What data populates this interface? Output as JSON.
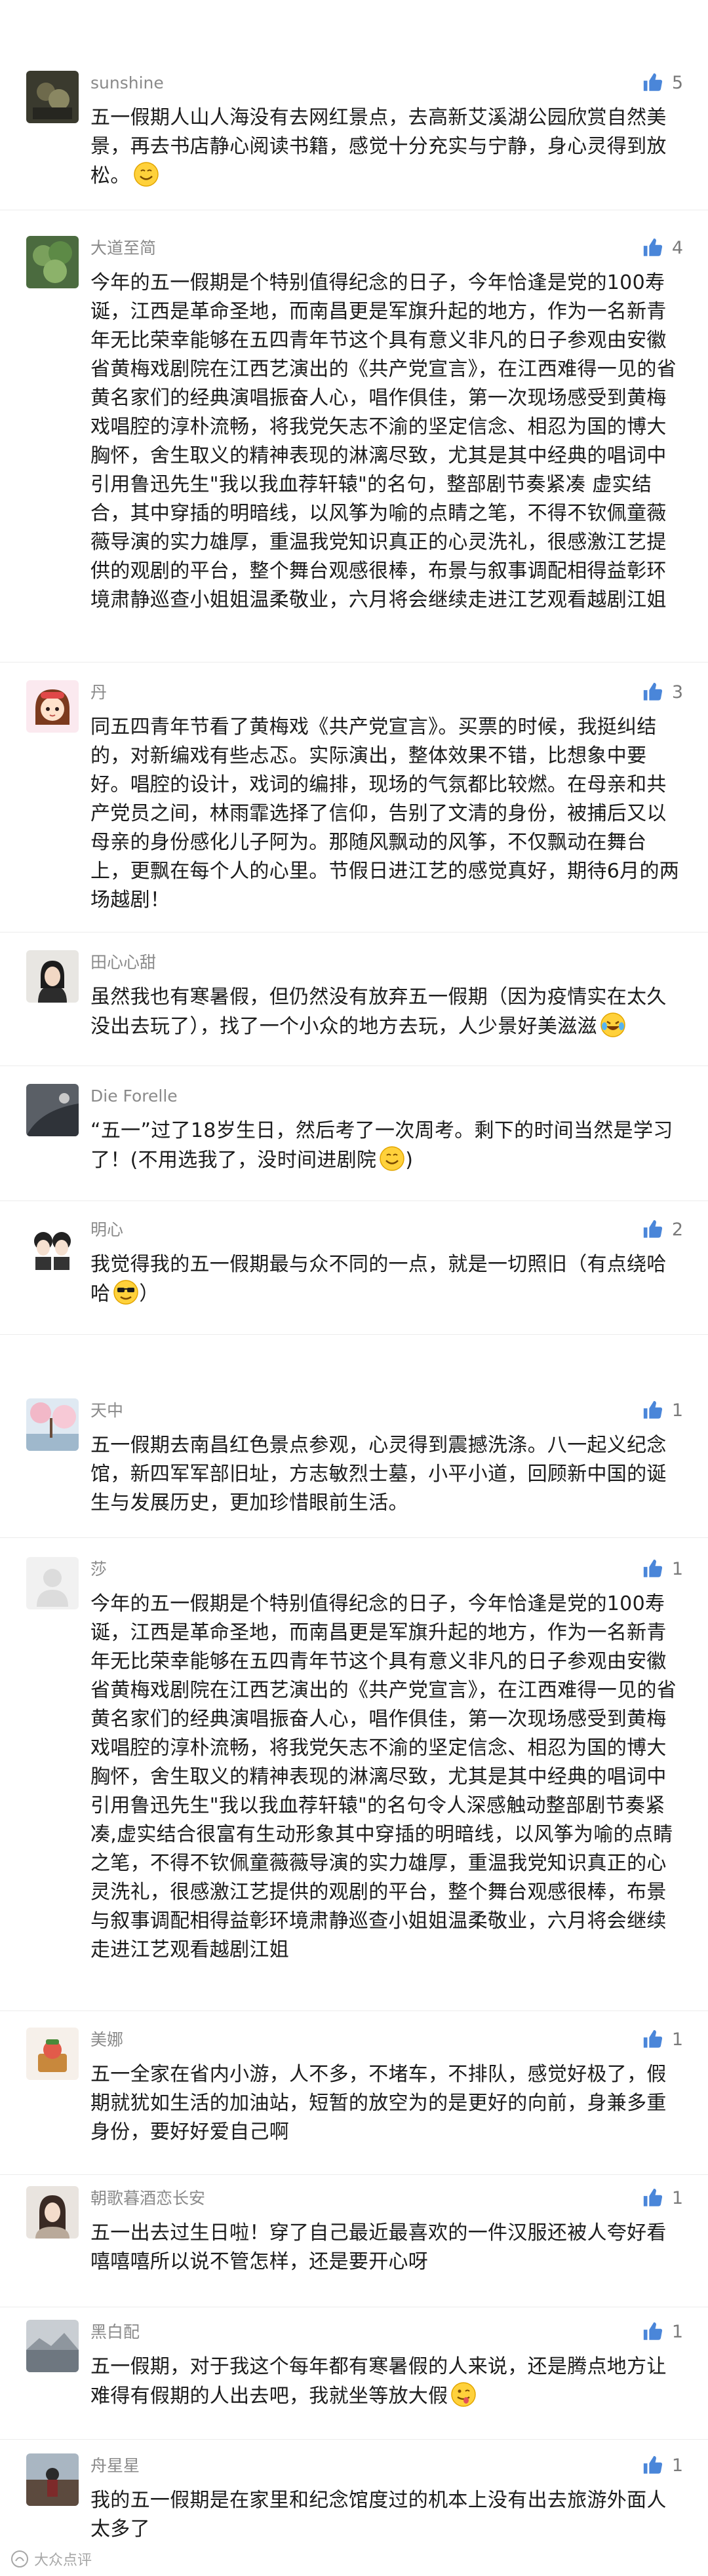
{
  "comments": [
    {
      "name": "sunshine",
      "likes": "5",
      "text": "五一假期人山人海没有去网红景点，去高新艾溪湖公园欣赏自然美景，再去书店静心阅读书籍，感觉十分充实与宁静，身心灵得到放松。"
    },
    {
      "name": "大道至简",
      "likes": "4",
      "text": "今年的五一假期是个特别值得纪念的日子，今年恰逢是党的100寿诞，江西是革命圣地，而南昌更是军旗升起的地方，作为一名新青年无比荣幸能够在五四青年节这个具有意义非凡的日子参观由安徽省黄梅戏剧院在江西艺演出的《共产党宣言》，在江西难得一见的省黄名家们的经典演唱振奋人心，唱作俱佳，第一次现场感受到黄梅戏唱腔的淳朴流畅，将我党矢志不渝的坚定信念、相忍为国的博大胸怀，舍生取义的精神表现的淋漓尽致，尤其是其中经典的唱词中引用鲁迅先生\"我以我血荐轩辕\"的名句，整部剧节奏紧凑 虚实结合，其中穿插的明暗线，以风筝为喻的点睛之笔，不得不钦佩童薇薇导演的实力雄厚，重温我党知识真正的心灵洗礼，很感激江艺提供的观剧的平台，整个舞台观感很棒，布景与叙事调配相得益彰环境肃静巡查小姐姐温柔敬业，六月将会继续走进江艺观看越剧江姐"
    },
    {
      "name": "丹",
      "likes": "3",
      "text": "同五四青年节看了黄梅戏《共产党宣言》。买票的时候，我挺纠结的，对新编戏有些忐忑。实际演出，整体效果不错，比想象中要好。唱腔的设计，戏词的编排，现场的气氛都比较燃。在母亲和共产党员之间，林雨霏选择了信仰，告别了文清的身份，被捕后又以母亲的身份感化儿子阿为。那随风飘动的风筝，不仅飘动在舞台上，更飘在每个人的心里。节假日进江艺的感觉真好，期待6月的两场越剧！"
    },
    {
      "name": "田心心甜",
      "likes": "",
      "text": "虽然我也有寒暑假，但仍然没有放弃五一假期（因为疫情实在太久没出去玩了），找了一个小众的地方去玩，人少景好美滋滋"
    },
    {
      "name": "Die Forelle",
      "likes": "",
      "text": "“五一”过了18岁生日，然后考了一次周考。剩下的时间当然是学习了！(不用选我了，没时间进剧院"
    },
    {
      "name": "明心",
      "likes": "2",
      "text": "我觉得我的五一假期最与众不同的一点，就是一切照旧（有点绕哈哈"
    },
    {
      "name": "天中",
      "likes": "1",
      "text": "五一假期去南昌红色景点参观，心灵得到震撼洗涤。八一起义纪念馆，新四军军部旧址，方志敏烈士墓，小平小道，回顾新中国的诞生与发展历史，更加珍惜眼前生活。"
    },
    {
      "name": "莎",
      "likes": "1",
      "text": "今年的五一假期是个特别值得纪念的日子，今年恰逢是党的100寿诞，江西是革命圣地，而南昌更是军旗升起的地方，作为一名新青年无比荣幸能够在五四青年节这个具有意义非凡的日子参观由安徽省黄梅戏剧院在江西艺演出的《共产党宣言》，在江西难得一见的省黄名家们的经典演唱振奋人心，唱作俱佳，第一次现场感受到黄梅戏唱腔的淳朴流畅，将我党矢志不渝的坚定信念、相忍为国的博大胸怀，舍生取义的精神表现的淋漓尽致，尤其是其中经典的唱词中引用鲁迅先生\"我以我血荐轩辕\"的名句令人深感触动整部剧节奏紧凑,虚实结合很富有生动形象其中穿插的明暗线，以风筝为喻的点睛之笔，不得不钦佩童薇薇导演的实力雄厚，重温我党知识真正的心灵洗礼，很感激江艺提供的观剧的平台，整个舞台观感很棒，布景与叙事调配相得益彰环境肃静巡查小姐姐温柔敬业，六月将会继续走进江艺观看越剧江姐"
    },
    {
      "name": "美娜",
      "likes": "1",
      "text": "五一全家在省内小游，人不多，不堵车，不排队，感觉好极了，假期就犹如生活的加油站，短暂的放空为的是更好的向前，身兼多重身份，要好好爱自己啊"
    },
    {
      "name": "朝歌暮酒恋长安",
      "likes": "1",
      "text": "五一出去过生日啦！穿了自己最近最喜欢的一件汉服还被人夸好看嘻嘻嘻所以说不管怎样，还是要开心呀"
    },
    {
      "name": "黑白配",
      "likes": "1",
      "text": "五一假期，对于我这个每年都有寒暑假的人来说，还是腾点地方让难得有假期的人出去吧，我就坐等放大假"
    },
    {
      "name": "舟星星",
      "likes": "1",
      "text": "我的五一假期是在家里和纪念馆度过的机本上没有出去旅游外面人太多了"
    }
  ],
  "watermark": "大众点评"
}
